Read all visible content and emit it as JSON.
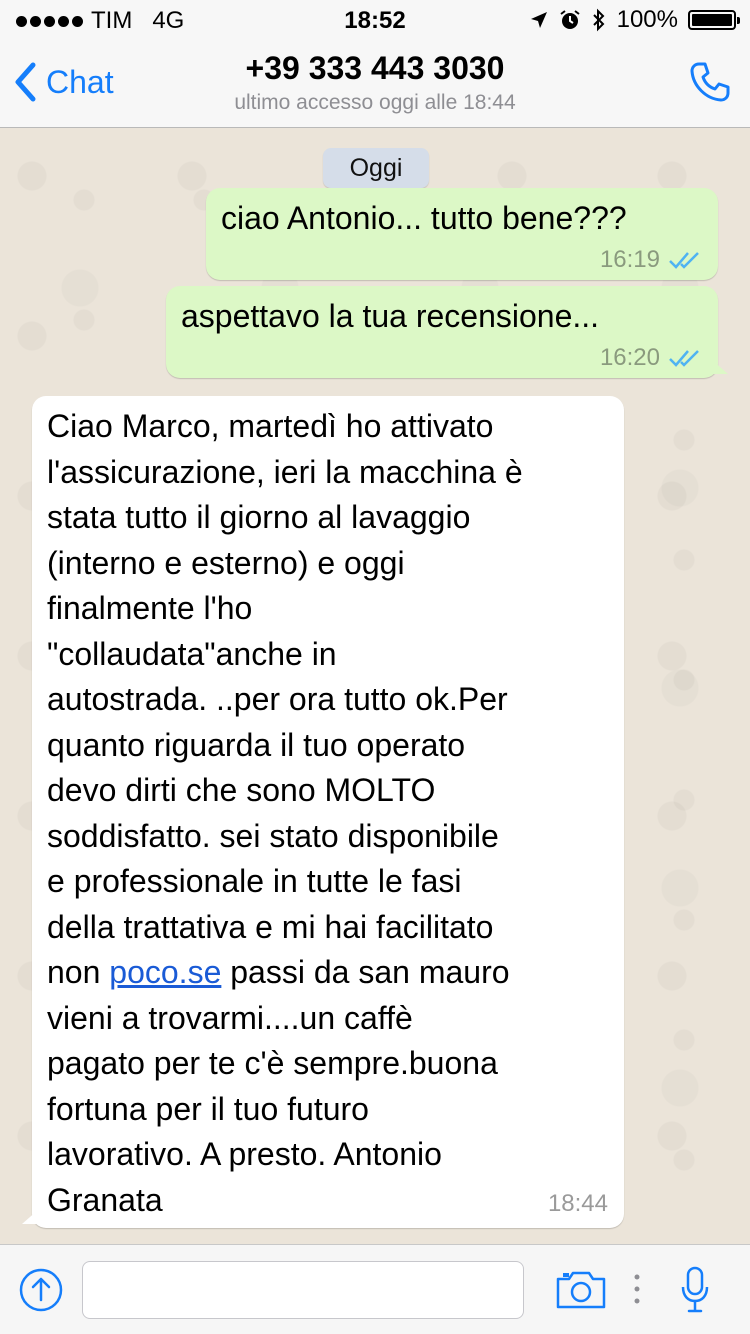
{
  "status_bar": {
    "carrier": "TIM",
    "network": "4G",
    "time": "18:52",
    "battery": "100%",
    "battery_level": 1.0
  },
  "nav": {
    "back_label": "Chat",
    "title": "+39 333 443 3030",
    "subtitle": "ultimo accesso oggi alle 18:44"
  },
  "chat": {
    "date_label": "Oggi",
    "messages": [
      {
        "direction": "out",
        "text": "ciao Antonio... tutto bene???",
        "time": "16:19",
        "status": "read"
      },
      {
        "direction": "out",
        "text": "aspettavo la tua recensione...",
        "time": "16:20",
        "status": "read"
      },
      {
        "direction": "in",
        "text_before_link": "Ciao Marco, martedì ho attivato\nl'assicurazione, ieri la macchina è\nstata tutto il giorno al lavaggio\n(interno e esterno) e oggi\nfinalmente l'ho\n\"collaudata\"anche in\nautostrada. ..per ora tutto ok.Per\nquanto riguarda il tuo operato\ndevo dirti che sono MOLTO\nsoddisfatto. sei stato disponibile\ne professionale in tutte le fasi\ndella trattativa e mi hai facilitato\nnon ",
        "link": "poco.se",
        "text_after_link": " passi da san mauro\nvieni a trovarmi....un caffè\npagato per te c'è sempre.buona\nfortuna per il tuo futuro\nlavorativo. A presto. Antonio\nGranata",
        "time": "18:44"
      }
    ]
  },
  "input": {
    "placeholder": ""
  },
  "colors": {
    "accent": "#157efb",
    "outgoing_bubble": "#dcf8c6",
    "incoming_bubble": "#ffffff",
    "read_ticks": "#4fb3f2",
    "date_pill": "#d5dde9"
  },
  "icons": [
    "back-chevron-icon",
    "phone-icon",
    "location-arrow-icon",
    "alarm-icon",
    "bluetooth-icon",
    "battery-icon",
    "double-check-icon",
    "attach-icon",
    "camera-icon",
    "more-dots-icon",
    "microphone-icon"
  ]
}
